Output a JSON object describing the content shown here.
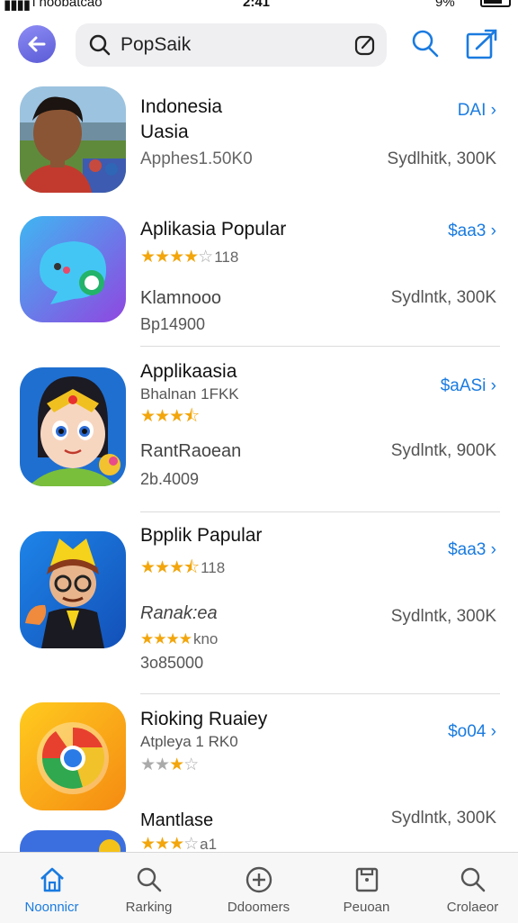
{
  "status_bar": {
    "carrier": "l noobatcao",
    "time": "2:41",
    "battery": "9%"
  },
  "header": {
    "search_query": "PopSaik"
  },
  "apps": [
    {
      "title_line1": "Indonesia",
      "title_line2": "Uasia",
      "meta": "Apphes1.50K0",
      "right": "Sydlhitk, 300K",
      "price": "DAI"
    },
    {
      "title_line1": "Aplikasia Popular",
      "rating_count": "118",
      "meta": "Klamnooo",
      "meta2": "Bp14900",
      "right": "Sydlntk, 300K",
      "price": "$aa3"
    },
    {
      "title_line1": "Applikaasia",
      "sub": "Bhalnan 1FKK",
      "meta": "RantRaoean",
      "meta2": "2b.4009",
      "right": "Sydlntk, 900K",
      "price": "$aASi"
    },
    {
      "title_line1": "Bpplik Papular",
      "rating_count": "118",
      "meta": "Ranak:ea",
      "meta2_stars": "kno",
      "meta3": "3o85000",
      "right": "Sydlntk, 300K",
      "price": "$aa3"
    },
    {
      "title_line1": "Rioking Ruaiey",
      "sub": "Atpleya 1 RK0",
      "meta": "Mantlase",
      "right": "Sydlntk, 300K",
      "price": "$o04",
      "extra_stars_count": "a1"
    }
  ],
  "ratings": [
    4,
    4,
    3.5,
    3.5,
    3,
    3
  ],
  "tabs": [
    {
      "label": "Noonnicr",
      "icon": "home-icon",
      "active": true
    },
    {
      "label": "Rarking",
      "icon": "search-icon"
    },
    {
      "label": "Ddoomers",
      "icon": "plus-circle-icon"
    },
    {
      "label": "Peuoan",
      "icon": "document-icon"
    },
    {
      "label": "Crolaeor",
      "icon": "search-icon"
    }
  ],
  "colors": {
    "accent": "#1a7be0",
    "star": "#f2a60c",
    "back_button": "#6d6de3"
  }
}
